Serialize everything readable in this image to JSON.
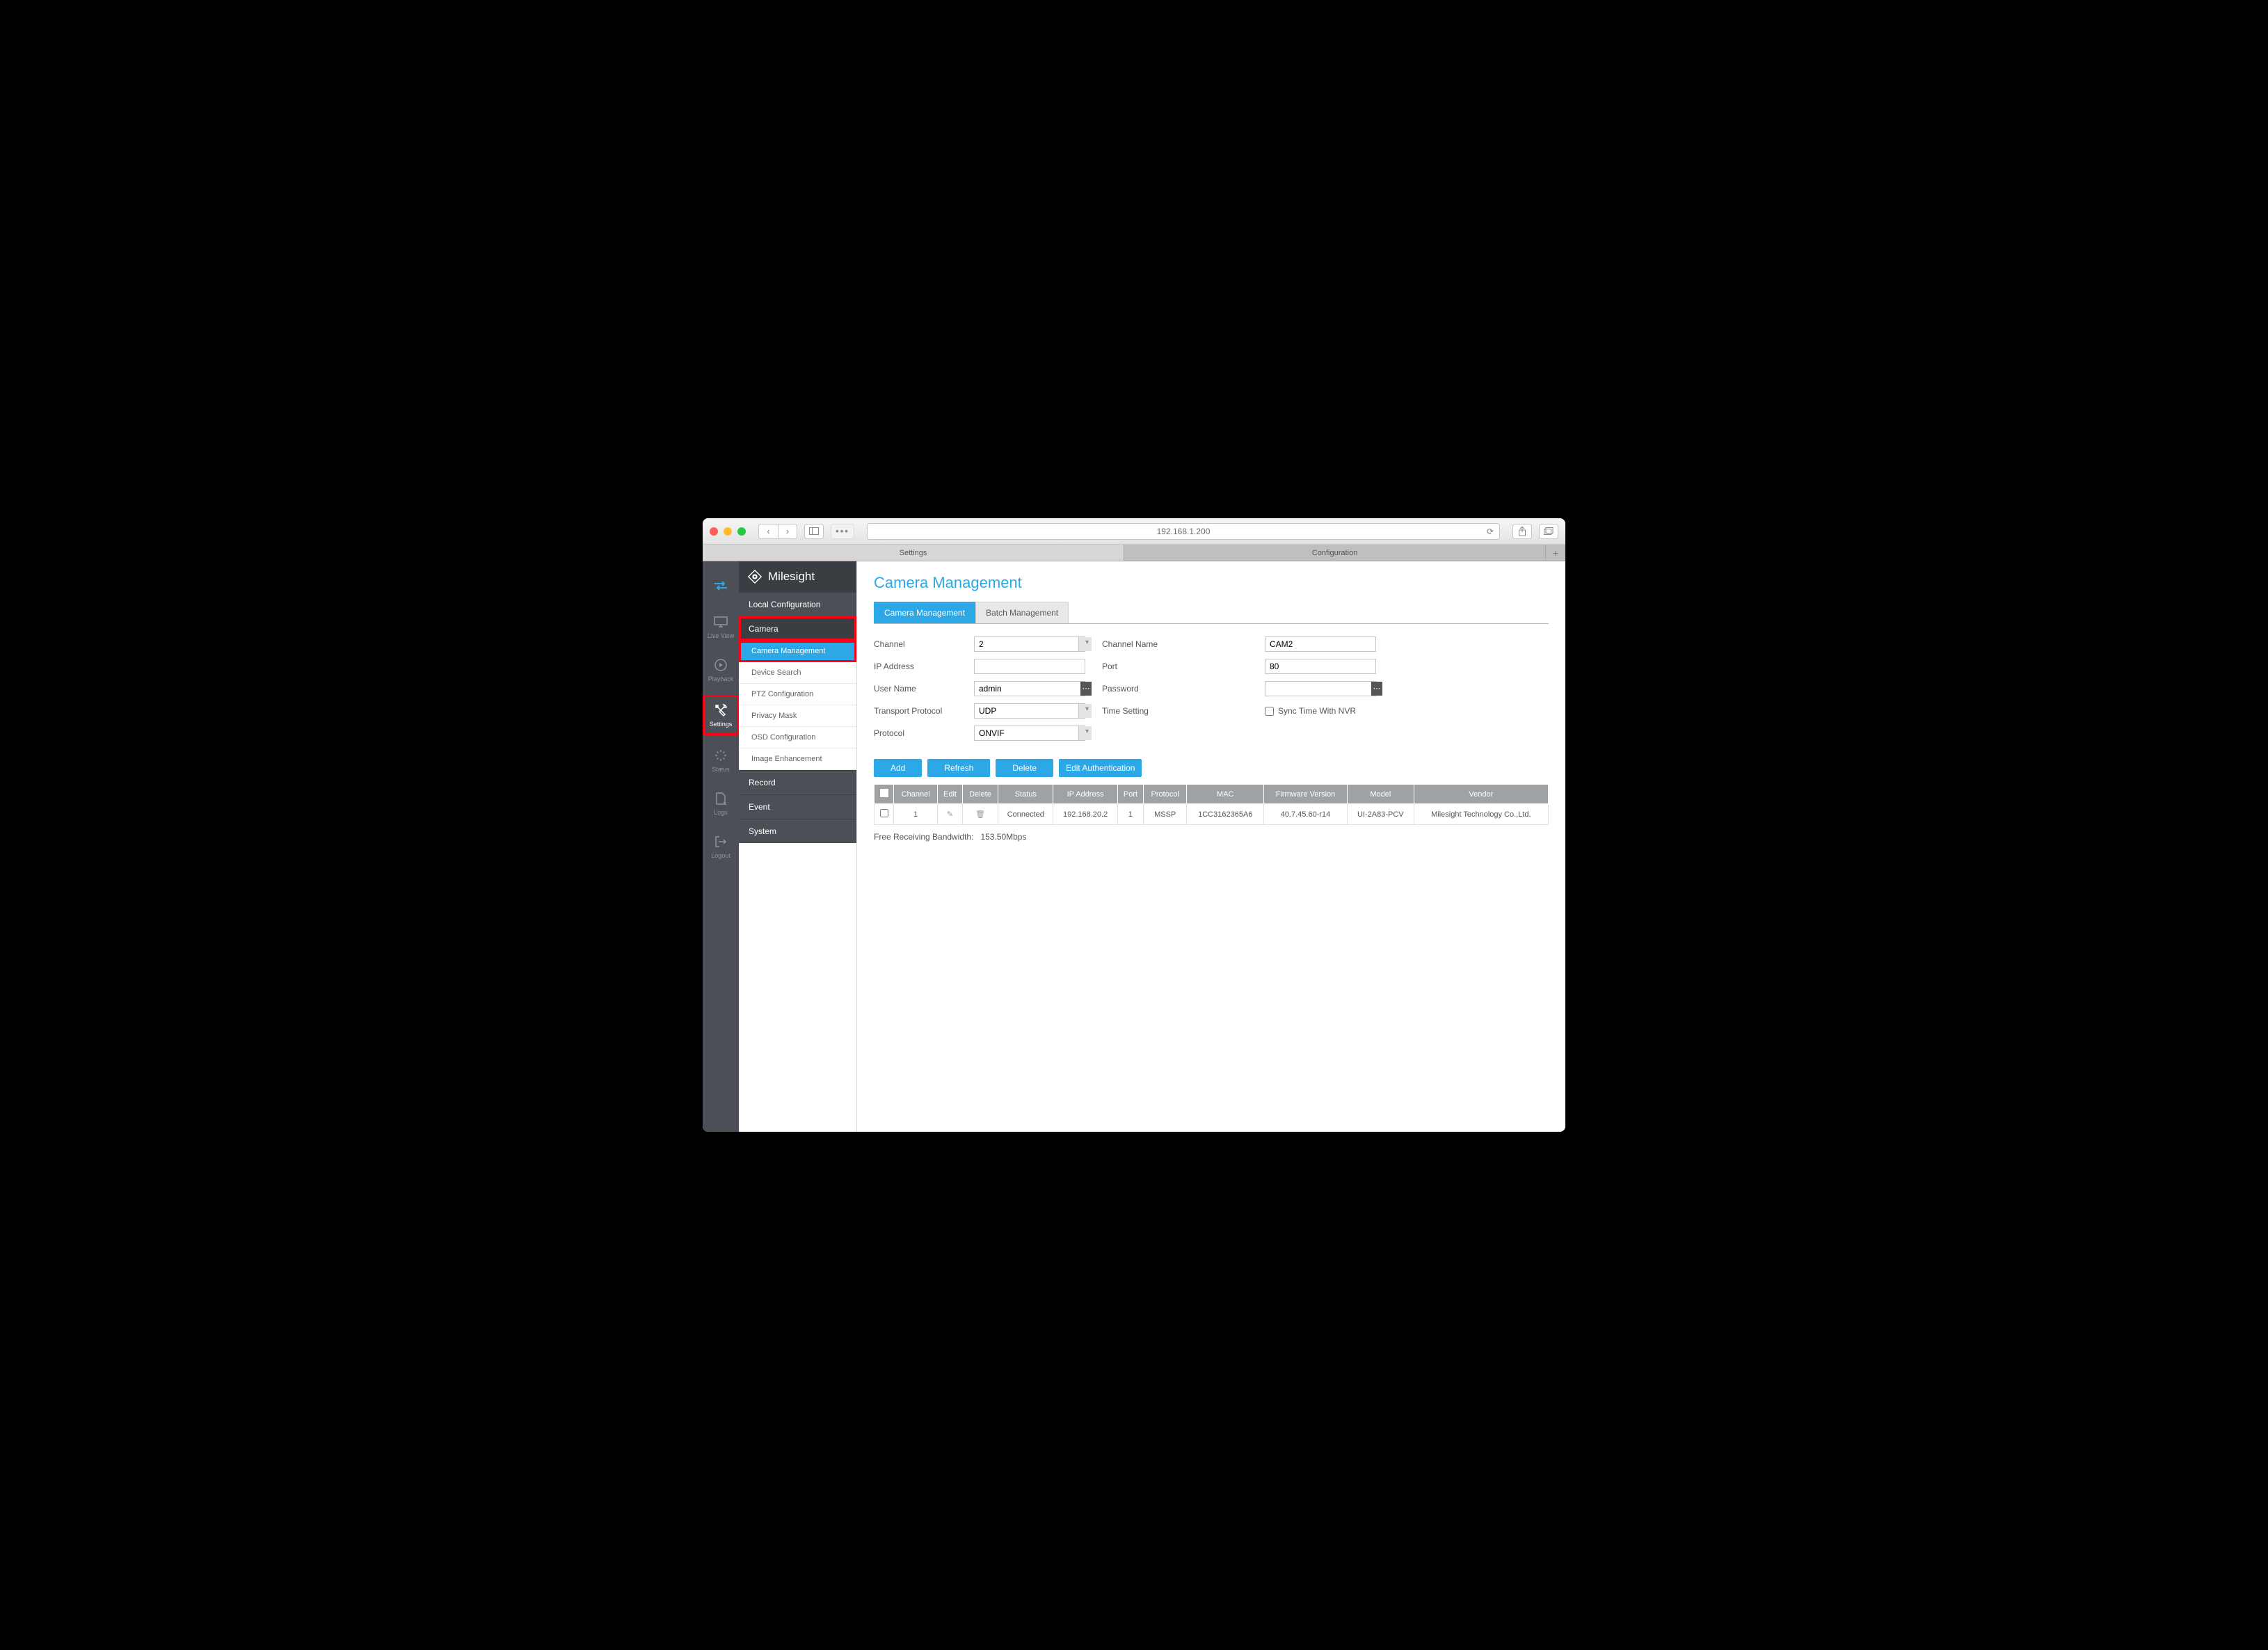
{
  "browser": {
    "url": "192.168.1.200",
    "tabs": [
      "Settings",
      "Configuration"
    ],
    "active_tab_index": 0
  },
  "brand": "Milesight",
  "rail": [
    {
      "id": "swap",
      "label": ""
    },
    {
      "id": "liveview",
      "label": "Live View"
    },
    {
      "id": "playback",
      "label": "Playback"
    },
    {
      "id": "settings",
      "label": "Settings"
    },
    {
      "id": "status",
      "label": "Status"
    },
    {
      "id": "logs",
      "label": "Logs"
    },
    {
      "id": "logout",
      "label": "Logout"
    }
  ],
  "sidebar": {
    "local_config": "Local Configuration",
    "camera_section": "Camera",
    "camera_items": [
      "Camera Management",
      "Device Search",
      "PTZ Configuration",
      "Privacy Mask",
      "OSD Configuration",
      "Image Enhancement"
    ],
    "record_section": "Record",
    "event_section": "Event",
    "system_section": "System"
  },
  "page": {
    "title": "Camera Management",
    "tabs": {
      "main": "Camera Management",
      "batch": "Batch Management"
    },
    "form": {
      "labels": {
        "channel": "Channel",
        "ip": "IP Address",
        "user": "User Name",
        "transport": "Transport Protocol",
        "protocol": "Protocol",
        "chname": "Channel Name",
        "port": "Port",
        "password": "Password",
        "time": "Time Setting",
        "sync": "Sync Time With NVR"
      },
      "values": {
        "channel": "2",
        "ip": "",
        "user": "admin",
        "transport": "UDP",
        "protocol": "ONVIF",
        "chname": "CAM2",
        "port": "80",
        "password": ""
      }
    },
    "buttons": {
      "add": "Add",
      "refresh": "Refresh",
      "delete": "Delete",
      "editauth": "Edit Authentication"
    },
    "table": {
      "headers": [
        "",
        "Channel",
        "Edit",
        "Delete",
        "Status",
        "IP Address",
        "Port",
        "Protocol",
        "MAC",
        "Firmware Version",
        "Model",
        "Vendor"
      ],
      "rows": [
        {
          "channel": "1",
          "status": "Connected",
          "ip": "192.168.20.2",
          "port": "1",
          "protocol": "MSSP",
          "mac": "1CC3162365A6",
          "fw": "40.7.45.60-r14",
          "model": "UI-2A83-PCV",
          "vendor": "Milesight Technology Co.,Ltd."
        }
      ]
    },
    "bandwidth_label": "Free Receiving Bandwidth:",
    "bandwidth_value": "153.50Mbps"
  }
}
